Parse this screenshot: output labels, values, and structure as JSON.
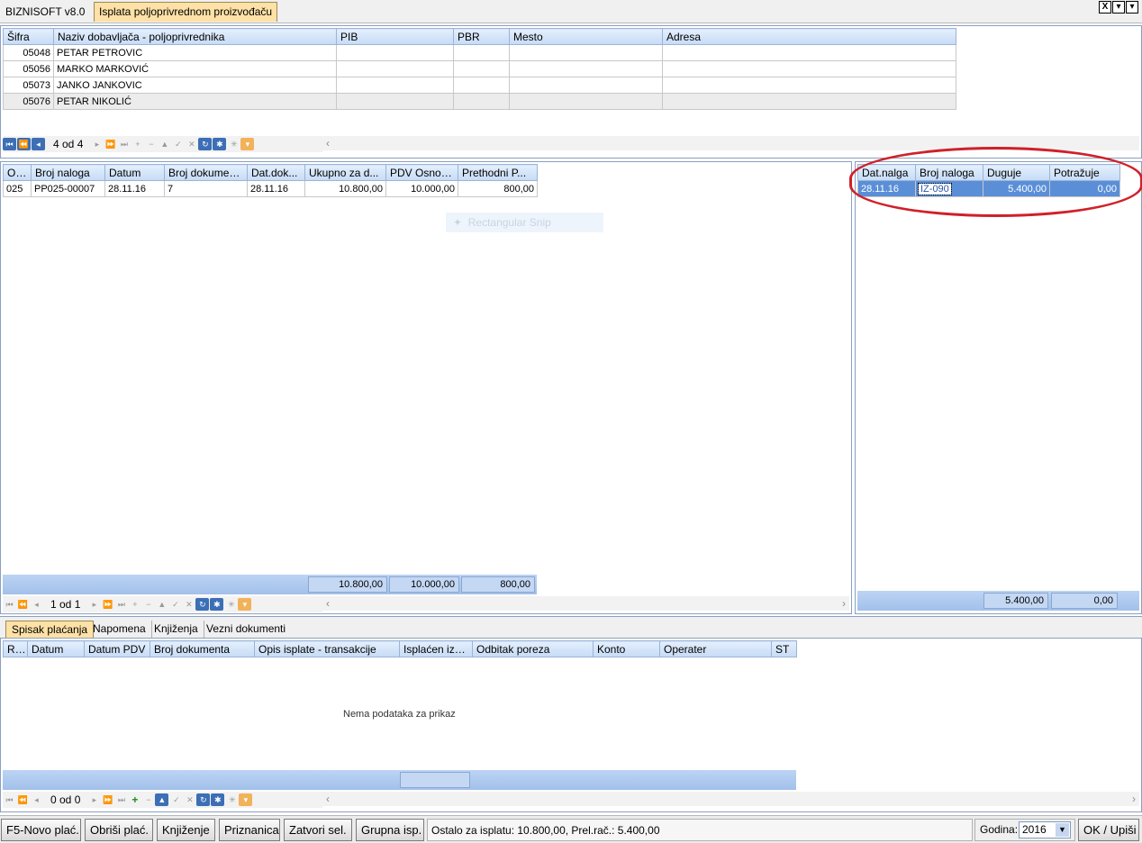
{
  "app": {
    "name": "BIZNISOFT v8.0",
    "active_tab": "Isplata poljoprivrednom proizvođaču"
  },
  "window_buttons": [
    "X",
    "▾",
    "▾"
  ],
  "suppliers": {
    "columns": [
      "Šifra",
      "Naziv dobavljača - poljoprivrednika",
      "PIB",
      "PBR",
      "Mesto",
      "Adresa"
    ],
    "rows": [
      {
        "sifra": "05048",
        "naziv": "PETAR PETROVIC",
        "pib": "",
        "pbr": "",
        "mesto": "",
        "adresa": ""
      },
      {
        "sifra": "05056",
        "naziv": "MARKO MARKOVIĆ",
        "pib": "",
        "pbr": "",
        "mesto": "",
        "adresa": ""
      },
      {
        "sifra": "05073",
        "naziv": "JANKO JANKOVIC",
        "pib": "",
        "pbr": "",
        "mesto": "",
        "adresa": ""
      },
      {
        "sifra": "05076",
        "naziv": "PETAR NIKOLIĆ",
        "pib": "",
        "pbr": "",
        "mesto": "",
        "adresa": ""
      }
    ],
    "nav_count": "4 od 4"
  },
  "documents": {
    "columns": [
      "OBJ",
      "Broj naloga",
      "Datum",
      "Broj dokumenta",
      "Dat.dok...",
      "Ukupno za d...",
      "PDV Osnovica",
      "Prethodni P..."
    ],
    "rows": [
      {
        "obj": "025",
        "broj_naloga": "PP025-00007",
        "datum": "28.11.16",
        "broj_dokumenta": "7",
        "dat_dok": "28.11.16",
        "ukupno": "10.800,00",
        "pdv_osnovica": "10.000,00",
        "prethodni": "800,00"
      }
    ],
    "totals": {
      "ukupno": "10.800,00",
      "pdv_osnovica": "10.000,00",
      "prethodni": "800,00"
    },
    "nav_count": "1 od 1"
  },
  "snip_hint": "Rectangular Snip",
  "ledger": {
    "columns": [
      "Dat.nalga",
      "Broj naloga",
      "Duguje",
      "Potražuje"
    ],
    "rows": [
      {
        "dat_nalga": "28.11.16",
        "broj_naloga": "IZ-090",
        "duguje": "5.400,00",
        "potrazuje": "0,00"
      }
    ],
    "totals": {
      "duguje": "5.400,00",
      "potrazuje": "0,00"
    }
  },
  "bottom_tabs": [
    "Spisak plaćanja",
    "Napomena",
    "Knjiženja",
    "Vezni dokumenti"
  ],
  "payments": {
    "columns": [
      "RBR",
      "Datum",
      "Datum PDV",
      "Broj dokumenta",
      "Opis isplate - transakcije",
      "Isplaćen iznos",
      "Odbitak poreza",
      "Konto",
      "Operater",
      "ST"
    ],
    "empty_message": "Nema podataka za prikaz",
    "nav_count": "0 od 0"
  },
  "toolbar": {
    "new_payment": "F5-Novo plać.",
    "delete_payment": "Obriši plać.",
    "posting": "Knjiženje",
    "receipt": "Priznanica",
    "close_selection": "Zatvori sel.",
    "group_payment": "Grupna isp.",
    "ok": "OK / Upiši"
  },
  "status_text": "Ostalo za isplatu: 10.800,00, Prel.rač.: 5.400,00",
  "year": {
    "label": "Godina:",
    "value": "2016"
  }
}
